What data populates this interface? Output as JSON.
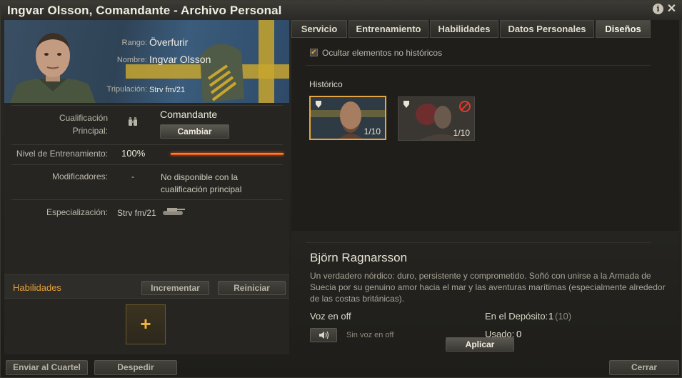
{
  "window": {
    "title": "Ingvar Olsson, Comandante - Archivo Personal",
    "info_icon": "i",
    "close_icon": "✕"
  },
  "profile": {
    "rank_label": "Rango:",
    "rank_value": "Överfurir",
    "name_label": "Nombre:",
    "name_value": "Ingvar Olsson",
    "crew_label": "Tripulación:",
    "crew_value": "Strv fm/21"
  },
  "qualification": {
    "label": "Cualificación Principal:",
    "value": "Comandante",
    "icon": "binoculars-icon",
    "change_button": "Cambiar"
  },
  "training": {
    "label": "Nivel de Entrenamiento:",
    "value": "100%",
    "progress_percent": 100
  },
  "modifiers": {
    "label": "Modificadores:",
    "value": "-",
    "note": "No disponible con la cualificación principal"
  },
  "specialization": {
    "label": "Especialización:",
    "value": "Strv fm/21",
    "icon": "tank-icon"
  },
  "skills": {
    "title": "Habilidades",
    "increment_button": "Incrementar",
    "reset_button": "Reiniciar",
    "add_icon": "+"
  },
  "tabs": [
    {
      "label": "Servicio",
      "active": false
    },
    {
      "label": "Entrenamiento",
      "active": false
    },
    {
      "label": "Habilidades",
      "active": false
    },
    {
      "label": "Datos Personales",
      "active": false
    },
    {
      "label": "Diseños",
      "active": true
    }
  ],
  "designs": {
    "hide_nonhistoric_label": "Ocultar elementos no históricos",
    "hide_nonhistoric_checked": true,
    "check_glyph": "✔",
    "section_label": "Histórico",
    "skins": [
      {
        "count": "1/10",
        "selected": true,
        "locked": false
      },
      {
        "count": "1/10",
        "selected": false,
        "locked": true
      }
    ],
    "hero_name": "Björn Ragnarsson",
    "hero_description": "Un verdadero nórdico: duro, persistente y comprometido. Soñó con unirse a la Armada de Suecia por su genuino amor hacia el mar y las aventuras marítimas (especialmente alrededor de las costas británicas).",
    "voice_label": "Voz en off",
    "voice_value": "Sin voz en off",
    "voice_icon": "speaker-icon",
    "depot_label": "En el Depósito:",
    "depot_value": "1",
    "depot_total": "(10)",
    "used_label": "Usado:",
    "used_value": "0",
    "apply_button": "Aplicar"
  },
  "footer": {
    "send_barracks_button": "Enviar al Cuartel",
    "dismiss_button": "Despedir",
    "close_button": "Cerrar"
  },
  "colors": {
    "accent": "#e7a640",
    "progress": "#e05b15",
    "locked": "#e03a2a"
  }
}
